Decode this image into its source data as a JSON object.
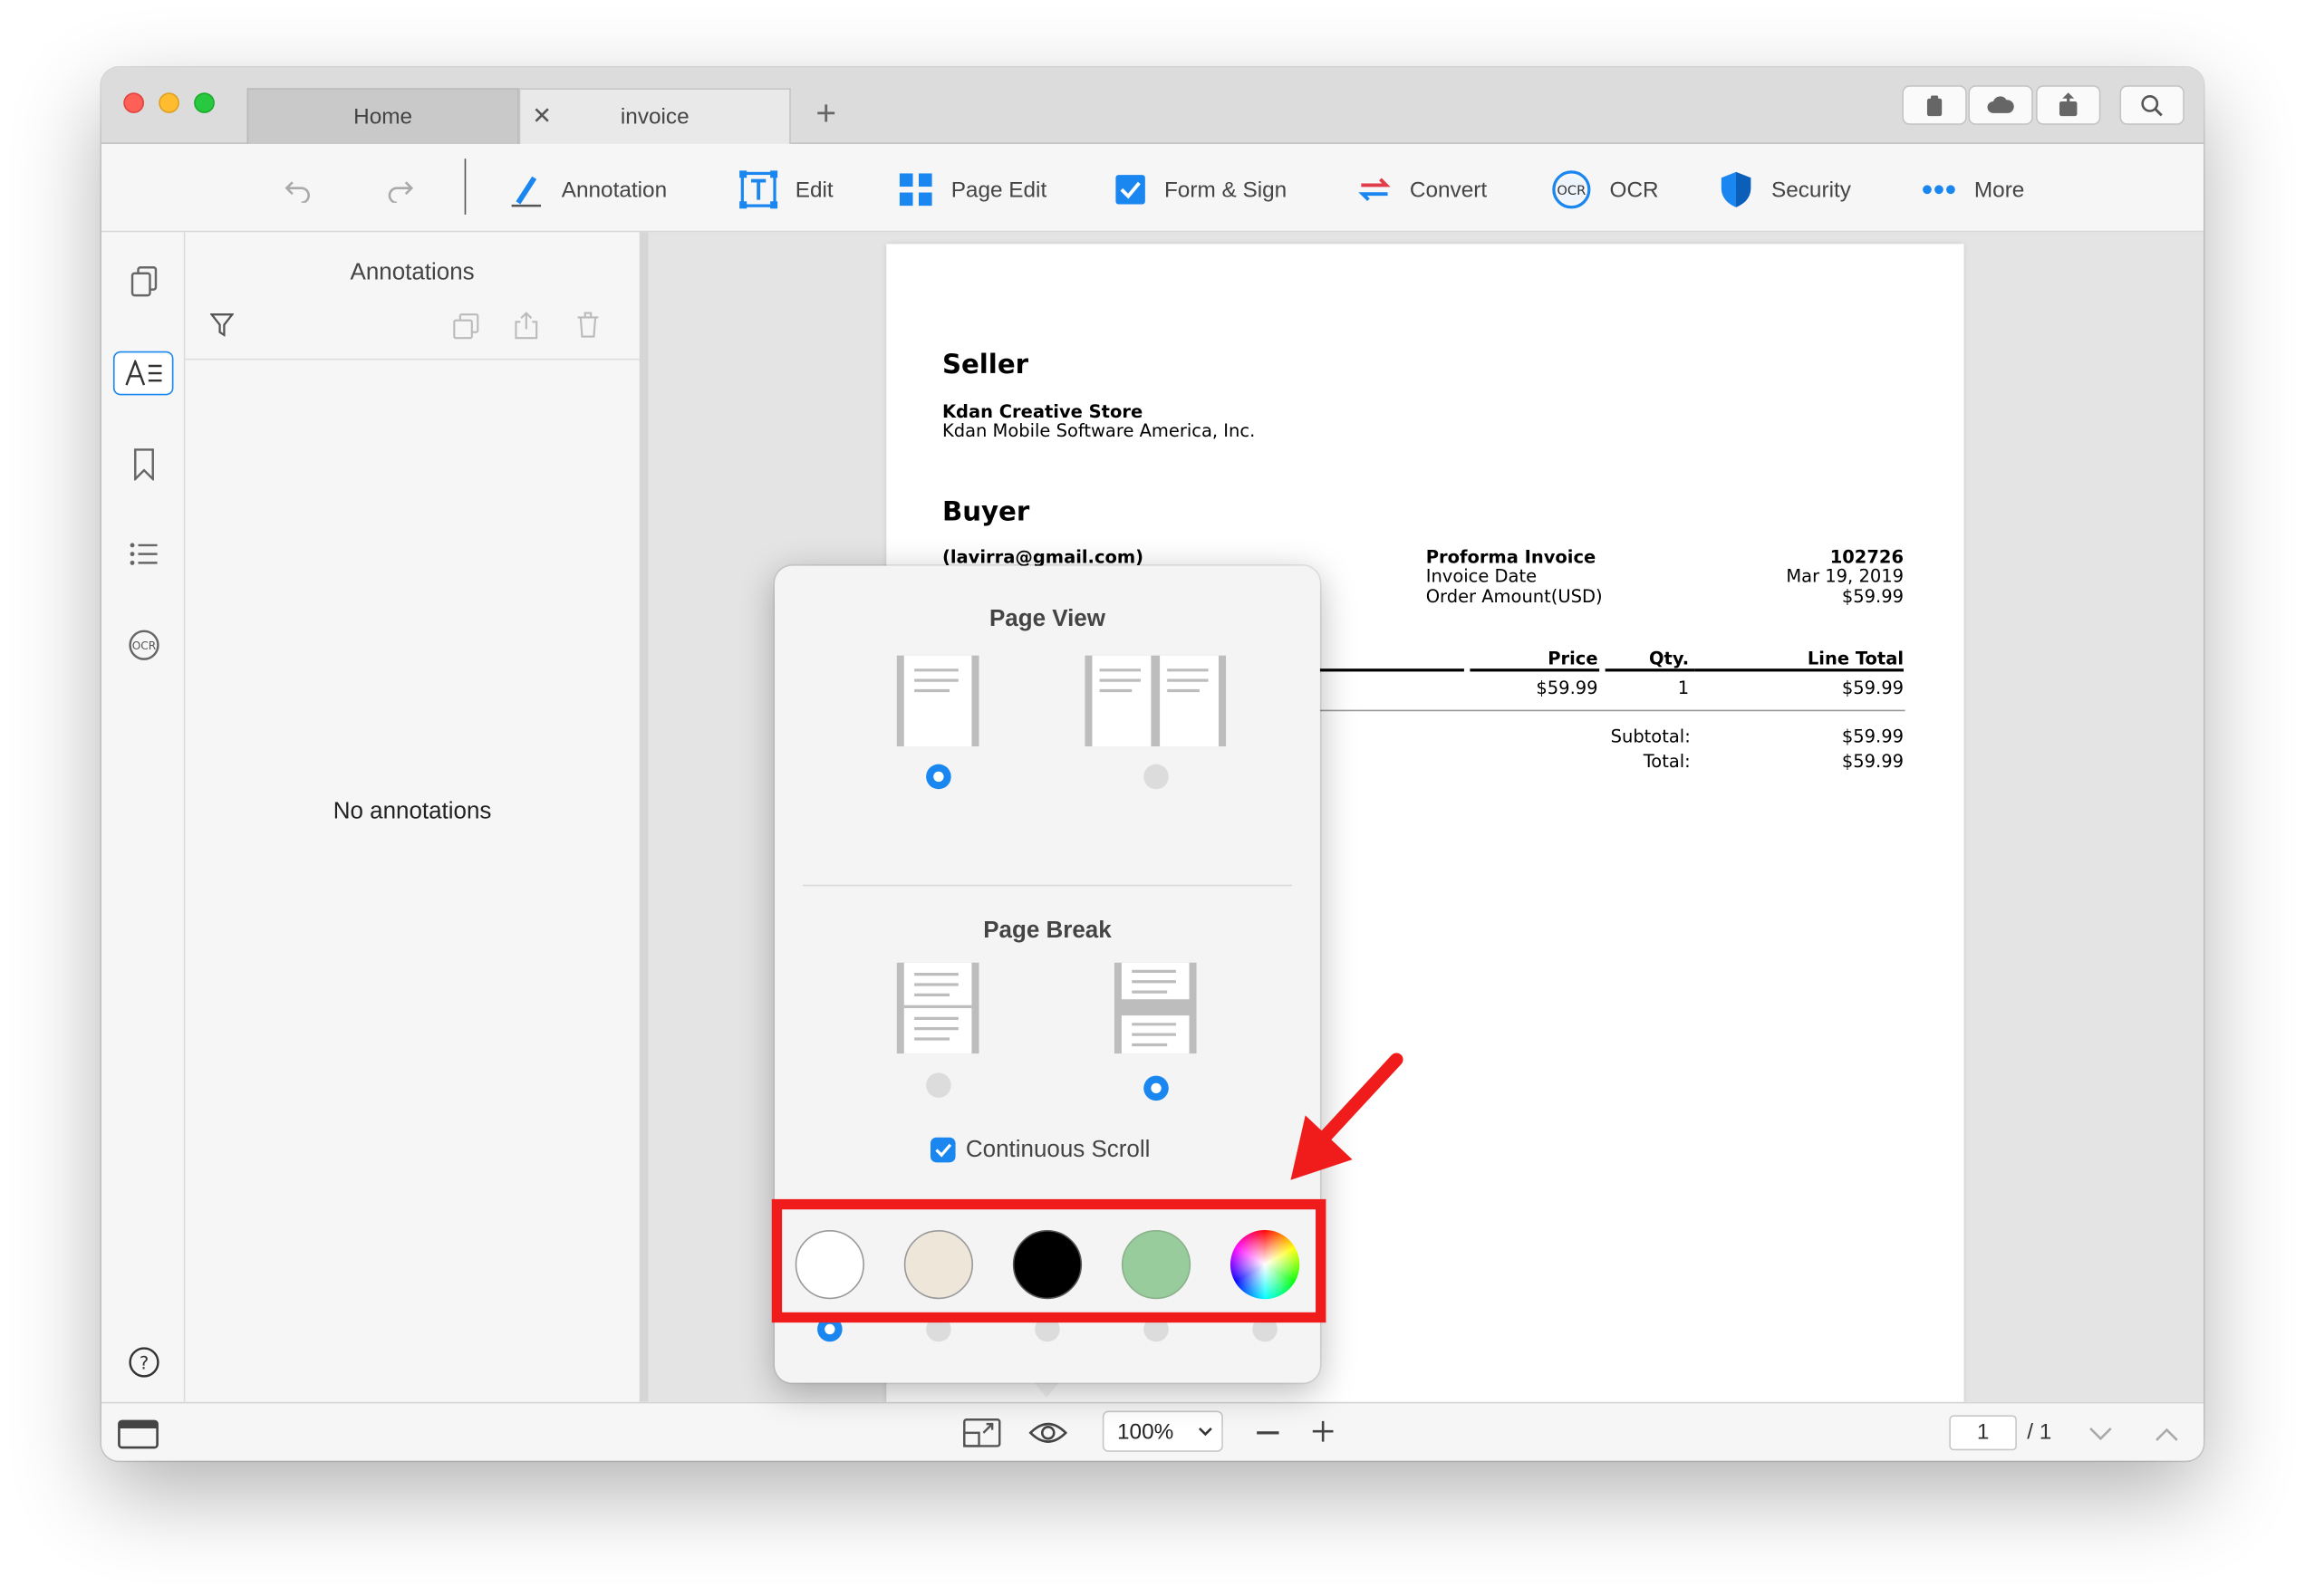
{
  "window": {
    "tabs": [
      {
        "label": "Home"
      },
      {
        "label": "invoice",
        "close": "✕"
      }
    ],
    "new_tab": "+"
  },
  "toolbar": {
    "items": [
      {
        "label": "Annotation",
        "icon": "annotation-pen-icon"
      },
      {
        "label": "Edit",
        "icon": "edit-text-icon"
      },
      {
        "label": "Page Edit",
        "icon": "page-edit-grid-icon"
      },
      {
        "label": "Form & Sign",
        "icon": "form-checkbox-icon"
      },
      {
        "label": "Convert",
        "icon": "convert-arrows-icon"
      },
      {
        "label": "OCR",
        "icon": "ocr-icon"
      },
      {
        "label": "Security",
        "icon": "security-shield-icon"
      },
      {
        "label": "More",
        "icon": "more-dots-icon"
      }
    ]
  },
  "sidebar": {
    "panel_title": "Annotations",
    "empty_text": "No annotations"
  },
  "document": {
    "seller_heading": "Seller",
    "seller_name": "Kdan Creative Store",
    "seller_company": "Kdan Mobile Software America, Inc.",
    "buyer_heading": "Buyer",
    "buyer_email": "(lavirra@gmail.com)",
    "invoice_title": "Proforma Invoice",
    "invoice_number": "102726",
    "invoice_date_label": "Invoice Date",
    "invoice_date": "Mar 19, 2019",
    "order_amount_label": "Order Amount(USD)",
    "order_amount": "$59.99",
    "table": {
      "headers": [
        "Price",
        "Qty.",
        "Line Total"
      ],
      "row": {
        "price": "$59.99",
        "qty": "1",
        "line_total": "$59.99"
      }
    },
    "subtotal_label": "Subtotal:",
    "subtotal": "$59.99",
    "total_label": "Total:",
    "total": "$59.99"
  },
  "popover": {
    "page_view_title": "Page View",
    "page_break_title": "Page Break",
    "continuous_scroll_label": "Continuous Scroll",
    "continuous_scroll_checked": true,
    "page_view_selected": "single",
    "page_break_selected": "separated",
    "background_colors": [
      "#ffffff",
      "#ede6d9",
      "#000000",
      "#99cc9c",
      "color-wheel"
    ],
    "background_selected": 0
  },
  "bottombar": {
    "zoom": "100%",
    "page_current": "1",
    "page_total": "/ 1"
  },
  "colors": {
    "accent": "#1a86f0",
    "highlight": "#f01c1c"
  }
}
